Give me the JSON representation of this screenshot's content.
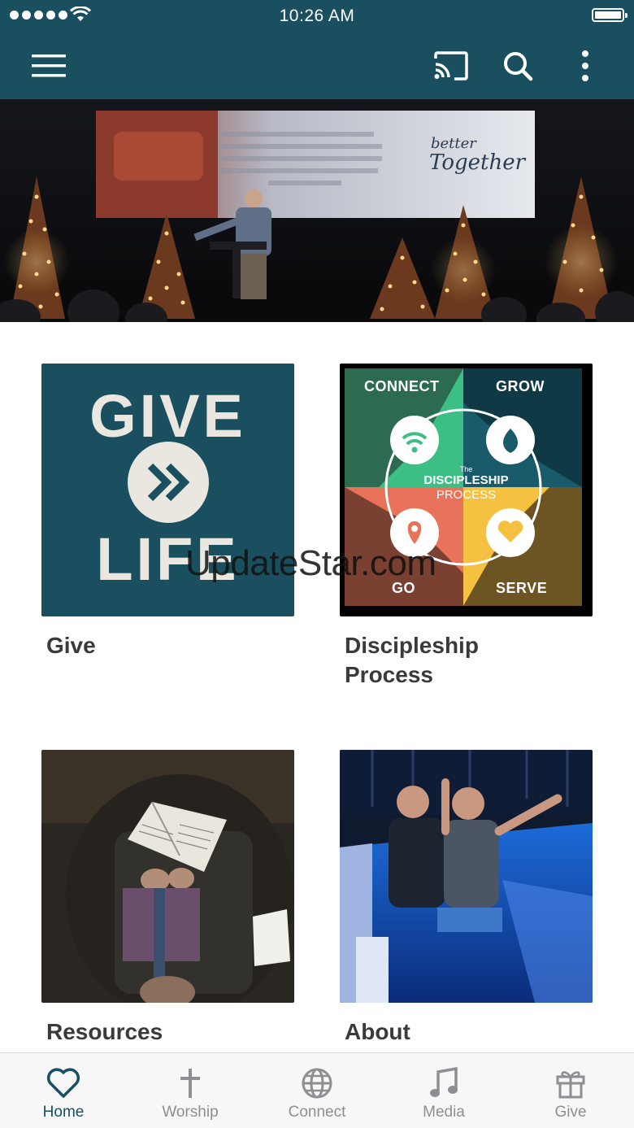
{
  "status_bar": {
    "time": "10:26 AM"
  },
  "hero": {
    "screen_text": "better Together"
  },
  "tiles": [
    {
      "label": "Give",
      "graphic": {
        "top": "GIVE",
        "bottom": "LIFE"
      }
    },
    {
      "label": "Discipleship Process",
      "graphic": {
        "q1": "CONNECT",
        "q2": "GROW",
        "q3": "GO",
        "q4": "SERVE",
        "center_small": "The",
        "center_l1": "DISCIPLESHIP",
        "center_l2": "PROCESS"
      }
    },
    {
      "label": "Resources"
    },
    {
      "label": "About"
    }
  ],
  "watermark": "UpdateStar.com",
  "tabbar": {
    "items": [
      {
        "label": "Home",
        "icon": "heart-icon",
        "active": true
      },
      {
        "label": "Worship",
        "icon": "cross-icon"
      },
      {
        "label": "Connect",
        "icon": "globe-icon"
      },
      {
        "label": "Media",
        "icon": "music-note-icon"
      },
      {
        "label": "Give",
        "icon": "gift-icon"
      }
    ]
  },
  "colors": {
    "brand": "#1a4f5f",
    "tab_inactive": "#8e8e93"
  }
}
